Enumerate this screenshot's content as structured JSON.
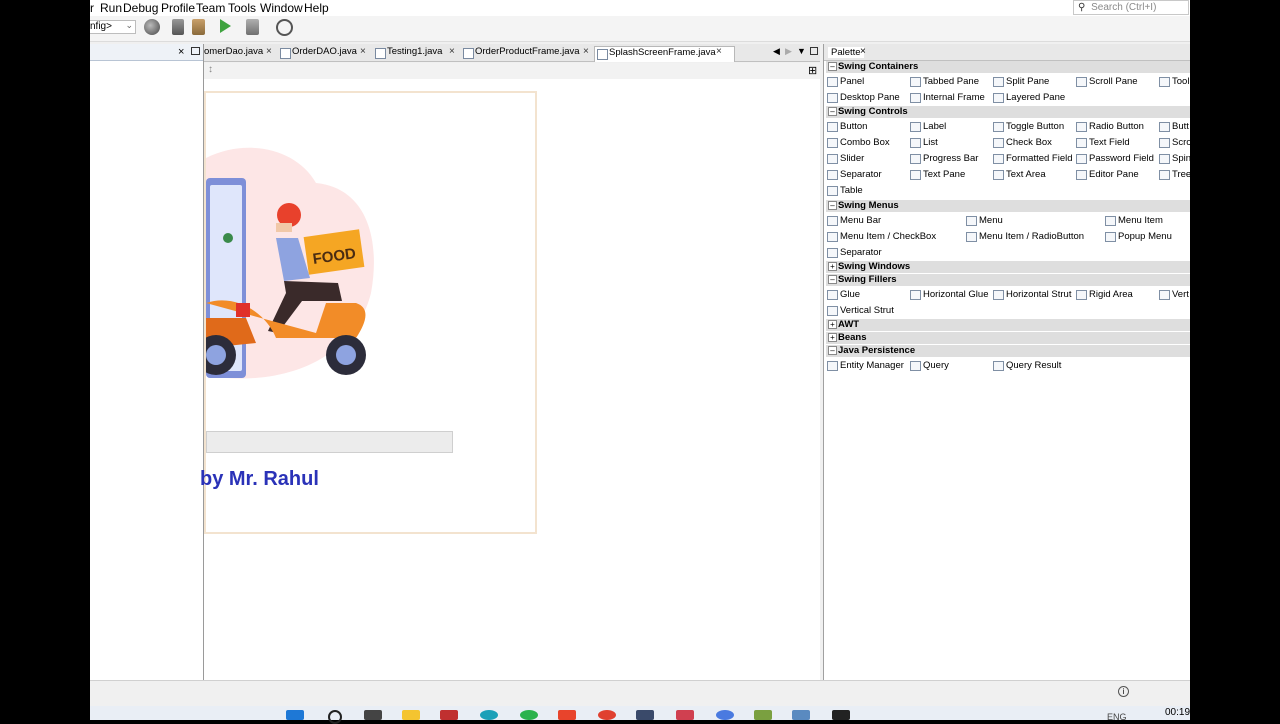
{
  "menubar": {
    "items": [
      "r",
      "Run",
      "Debug",
      "Profile",
      "Team",
      "Tools",
      "Window",
      "Help"
    ],
    "search_placeholder": "Search (Ctrl+I)"
  },
  "toolbar": {
    "config_value": "nfig>"
  },
  "editor_tabs": [
    {
      "label": "omerDao.java"
    },
    {
      "label": "OrderDAO.java"
    },
    {
      "label": "Testing1.java"
    },
    {
      "label": "OrderProductFrame.java"
    },
    {
      "label": "SplashScreenFrame.java",
      "active": true
    }
  ],
  "form": {
    "badge_text": "FOOD",
    "credit_text": "by Mr. Rahul"
  },
  "palette": {
    "tab_label": "Palette",
    "categories": [
      {
        "name": "Swing Containers",
        "items": [
          "Panel",
          "Tabbed Pane",
          "Split Pane",
          "Scroll Pane",
          "Tool",
          "Desktop Pane",
          "Internal Frame",
          "Layered Pane"
        ]
      },
      {
        "name": "Swing Controls",
        "items": [
          "Button",
          "Label",
          "Toggle Button",
          "Radio Button",
          "Butt",
          "Combo Box",
          "List",
          "Check Box",
          "Text Field",
          "Scro",
          "Slider",
          "Progress Bar",
          "Formatted Field",
          "Password Field",
          "Spin",
          "Separator",
          "Text Pane",
          "Text Area",
          "Editor Pane",
          "Tree",
          "Table"
        ]
      },
      {
        "name": "Swing Menus",
        "items": [
          "Menu Bar",
          "Menu",
          "Menu Item",
          "Menu Item / CheckBox",
          "Menu Item / RadioButton",
          "Popup Menu",
          "Separator"
        ]
      },
      {
        "name": "Swing Windows",
        "items": []
      },
      {
        "name": "Swing Fillers",
        "items": [
          "Glue",
          "Horizontal Glue",
          "Horizontal Strut",
          "Rigid Area",
          "Vert",
          "Vertical Strut"
        ]
      },
      {
        "name": "AWT",
        "items": []
      },
      {
        "name": "Beans",
        "items": []
      },
      {
        "name": "Java Persistence",
        "items": [
          "Entity Manager",
          "Query",
          "Query Result"
        ]
      }
    ]
  },
  "taskbar": {
    "clock": "00:19",
    "lang": "ENG"
  },
  "colors": {
    "accent": "#2a32b8",
    "scooter": "#f28c28",
    "badge": "#f5a623"
  }
}
